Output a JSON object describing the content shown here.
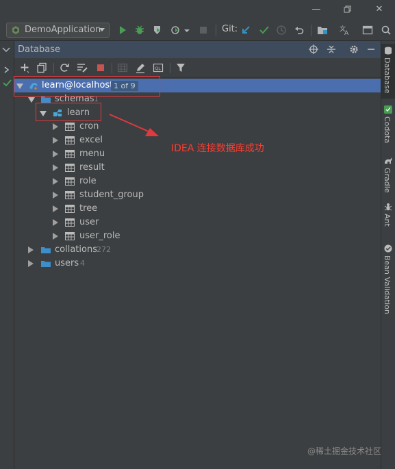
{
  "toolbar": {
    "run_config": "DemoApplication",
    "git_label": "Git:"
  },
  "panel": {
    "title": "Database"
  },
  "tree": {
    "datasource": {
      "label": "learn@localhost",
      "badge": "1 of 9"
    },
    "schemas": {
      "label": "schemas",
      "count": "1"
    },
    "schema": {
      "label": "learn"
    },
    "tables": [
      "cron",
      "excel",
      "menu",
      "result",
      "role",
      "student_group",
      "tree",
      "user",
      "user_role"
    ],
    "collations": {
      "label": "collations",
      "count": "272"
    },
    "users": {
      "label": "users",
      "count": "4"
    }
  },
  "annotation": {
    "text": "IDEA 连接数据库成功"
  },
  "right_stripe": {
    "tabs": [
      "Database",
      "Codota",
      "Gradle",
      "Ant",
      "Bean Validation"
    ]
  },
  "watermark": "@稀土掘金技术社区",
  "colors": {
    "selection": "#4b6eaf",
    "annotation_red": "#e0393e",
    "run_green": "#499c54",
    "folder_blue": "#3d8ec9"
  }
}
